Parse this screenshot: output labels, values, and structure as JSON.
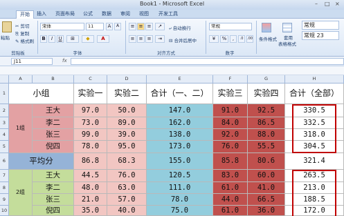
{
  "window": {
    "title": "Book1 - Microsoft Excel",
    "controls": [
      "–",
      "□",
      "×"
    ]
  },
  "tabs": [
    {
      "label": "开始",
      "active": true
    },
    {
      "label": "插入"
    },
    {
      "label": "页面布局"
    },
    {
      "label": "公式"
    },
    {
      "label": "数据"
    },
    {
      "label": "审阅"
    },
    {
      "label": "视图"
    },
    {
      "label": "开发工具"
    }
  ],
  "ribbon": {
    "clipboard": {
      "paste": "粘贴",
      "cut": "剪切",
      "copy": "复制",
      "format_painter": "格式刷",
      "group": "剪贴板"
    },
    "font": {
      "font_name": "宋体",
      "font_size": "11",
      "group": "字体"
    },
    "alignment": {
      "wrap_text": "自动换行",
      "merge_center": "合并后居中",
      "group": "对齐方式"
    },
    "number": {
      "format": "常规",
      "group": "数字"
    },
    "styles": {
      "conditional": "条件格式",
      "table_format_1": "套用",
      "table_format_2": "表格格式",
      "style_gallery": [
        "常规",
        "常规 23"
      ]
    }
  },
  "formula_bar": {
    "name_box": "J11",
    "fx": "fx",
    "content": ""
  },
  "columns": [
    "A",
    "B",
    "C",
    "D",
    "E",
    "F",
    "G",
    "H"
  ],
  "rows": [
    "1",
    "2",
    "3",
    "4",
    "5",
    "6",
    "7",
    "8",
    "9",
    "10"
  ],
  "sheet": {
    "headers": [
      "小组",
      "实验一",
      "实验二",
      "合计（一、二）",
      "实验三",
      "实验四",
      "合计（全部）"
    ],
    "group1_label": "1组",
    "group2_label": "2组",
    "avg_label": "平均分",
    "group1": [
      {
        "name": "王大",
        "e1": "97.0",
        "e2": "50.0",
        "sum12": "147.0",
        "e3": "91.0",
        "e4": "92.5",
        "total": "330.5"
      },
      {
        "name": "李二",
        "e1": "73.0",
        "e2": "89.0",
        "sum12": "162.0",
        "e3": "84.0",
        "e4": "86.5",
        "total": "332.5"
      },
      {
        "name": "张三",
        "e1": "99.0",
        "e2": "39.0",
        "sum12": "138.0",
        "e3": "92.0",
        "e4": "88.0",
        "total": "318.0"
      },
      {
        "name": "倪四",
        "e1": "78.0",
        "e2": "95.0",
        "sum12": "173.0",
        "e3": "76.0",
        "e4": "55.5",
        "total": "304.5"
      }
    ],
    "average": {
      "e1": "86.8",
      "e2": "68.3",
      "sum12": "155.0",
      "e3": "85.8",
      "e4": "80.6",
      "total": "321.4"
    },
    "group2": [
      {
        "name": "王大",
        "e1": "44.5",
        "e2": "76.0",
        "sum12": "120.5",
        "e3": "83.0",
        "e4": "60.0",
        "total": "263.5"
      },
      {
        "name": "李二",
        "e1": "48.0",
        "e2": "63.0",
        "sum12": "111.0",
        "e3": "61.0",
        "e4": "41.0",
        "total": "213.0"
      },
      {
        "name": "张三",
        "e1": "21.0",
        "e2": "57.0",
        "sum12": "78.0",
        "e3": "44.0",
        "e4": "66.5",
        "total": "188.5"
      },
      {
        "name": "倪四",
        "e1": "35.0",
        "e2": "40.0",
        "sum12": "75.0",
        "e3": "61.0",
        "e4": "36.0",
        "total": "172.0"
      }
    ]
  },
  "colors": {
    "group1_fill": "#e3a1a3",
    "group2_fill": "#c4dd9b",
    "exp12_fill": "#f2c6c2",
    "sum12_fill": "#93cddd",
    "exp34_fill": "#c0504d",
    "avg_fill": "#95b3d7",
    "total_border": "#c00000"
  }
}
